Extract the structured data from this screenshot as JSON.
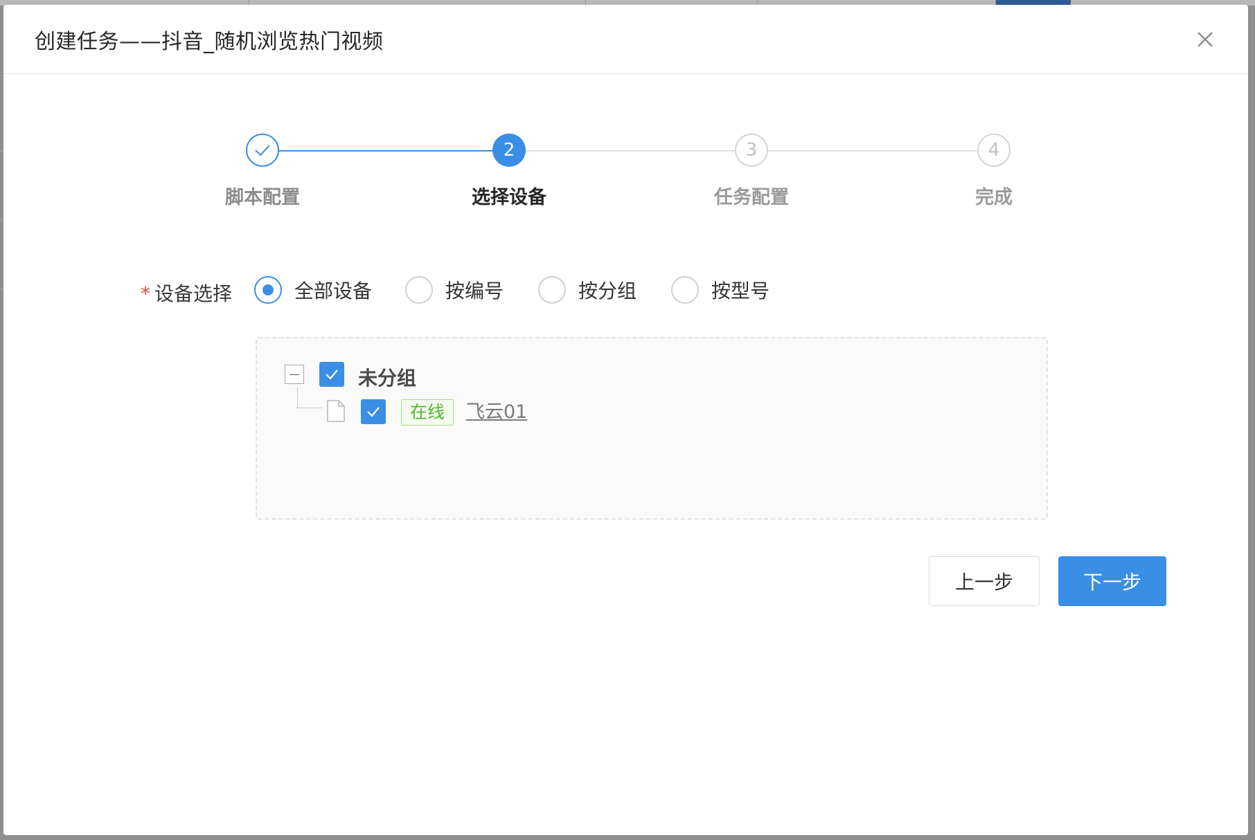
{
  "modal": {
    "title": "创建任务——抖音_随机浏览热门视频"
  },
  "steps": [
    {
      "label": "脚本配置",
      "status": "finished",
      "index": "1"
    },
    {
      "label": "选择设备",
      "status": "current",
      "index": "2"
    },
    {
      "label": "任务配置",
      "status": "waiting",
      "index": "3"
    },
    {
      "label": "完成",
      "status": "waiting",
      "index": "4"
    }
  ],
  "form": {
    "required_mark": "*",
    "device_select_label": "设备选择",
    "options": [
      {
        "label": "全部设备",
        "checked": true
      },
      {
        "label": "按编号",
        "checked": false
      },
      {
        "label": "按分组",
        "checked": false
      },
      {
        "label": "按型号",
        "checked": false
      }
    ]
  },
  "tree": {
    "group_label": "未分组",
    "group_checked": true,
    "devices": [
      {
        "status_tag": "在线",
        "name": "飞云01",
        "checked": true
      }
    ]
  },
  "buttons": {
    "prev": "上一步",
    "next": "下一步"
  },
  "colors": {
    "primary": "#3a8ee6",
    "online_tag": "#52b433",
    "required": "#e64a3b"
  }
}
